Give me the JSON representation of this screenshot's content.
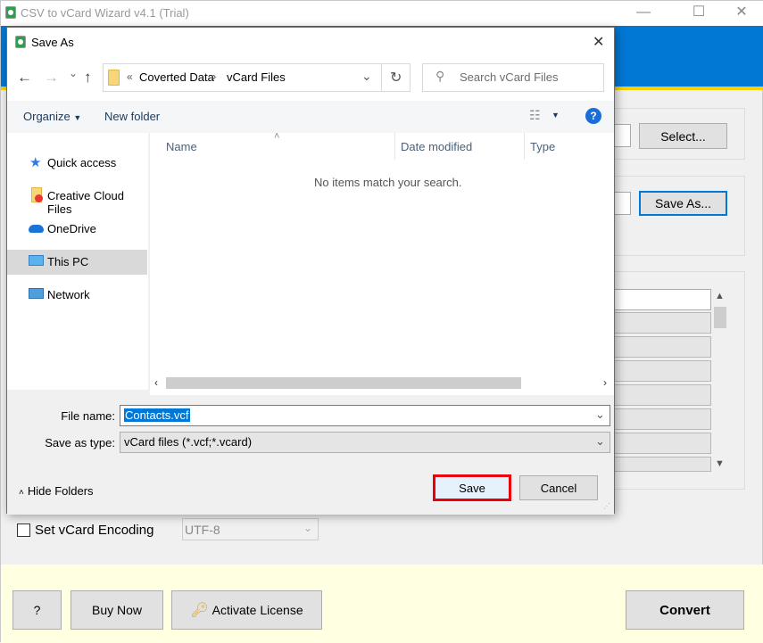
{
  "app": {
    "title": "CSV to vCard Wizard v4.1 (Trial)",
    "window_controls": {
      "minimize": "—",
      "maximize": "☐",
      "close": "✕"
    },
    "brand_color": "#0078d4",
    "accent_stripe": "#f7d000",
    "select_button": "Select...",
    "save_as_button": "Save As...",
    "encoding_checkbox_label": "Set vCard Encoding",
    "encoding_checked": false,
    "encoding_value": "UTF-8",
    "footer": {
      "help_button": "?",
      "buy_button": "Buy Now",
      "activate_button": "Activate License",
      "convert_button": "Convert"
    }
  },
  "dialog": {
    "title": "Save As",
    "close": "✕",
    "nav": {
      "back": "←",
      "forward": "→",
      "recent": "⌄",
      "up": "↑"
    },
    "breadcrumb": {
      "overflow": "«",
      "items": [
        "Coverted Data",
        "vCard Files"
      ],
      "separator": "›"
    },
    "refresh": "↻",
    "search_placeholder": "Search vCard Files",
    "toolbar": {
      "organize": "Organize",
      "new_folder": "New folder",
      "help": "?"
    },
    "navpane": [
      {
        "label": "Quick access",
        "icon": "star-icon"
      },
      {
        "label": "Creative Cloud Files",
        "icon": "creative-cloud-folder-icon"
      },
      {
        "label": "OneDrive",
        "icon": "cloud-icon"
      },
      {
        "label": "This PC",
        "icon": "computer-icon",
        "selected": true
      },
      {
        "label": "Network",
        "icon": "network-icon"
      }
    ],
    "columns": [
      "Name",
      "Date modified",
      "Type"
    ],
    "empty_message": "No items match your search.",
    "file_name_label": "File name:",
    "file_name_value": "Contacts.vcf",
    "save_type_label": "Save as type:",
    "save_type_value": "vCard files (*.vcf;*.vcard)",
    "hide_folders": "Hide Folders",
    "save_button": "Save",
    "cancel_button": "Cancel",
    "highlight_color": "#e8000b"
  }
}
